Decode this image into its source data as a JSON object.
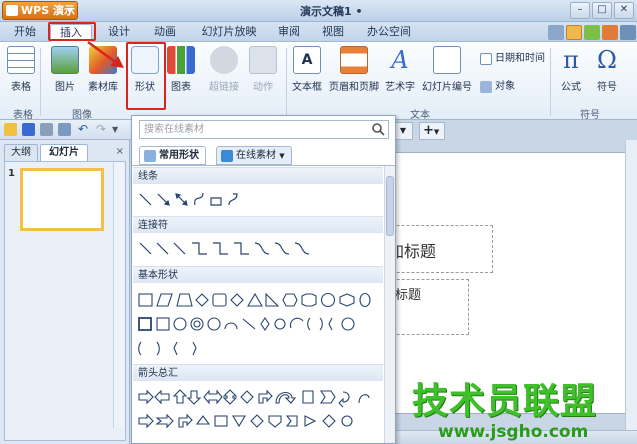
{
  "titlebar": {
    "app_button": "WPS 演示",
    "doc_title": "演示文稿1 •",
    "controls": [
      "–",
      "□",
      "✕"
    ]
  },
  "tabs": [
    "开始",
    "插入",
    "设计",
    "动画",
    "幻灯片放映",
    "审阅",
    "视图",
    "办公空间"
  ],
  "active_tab": "插入",
  "ribbon": {
    "table": "表格",
    "picture": "图片",
    "material": "素材库",
    "shape": "形状",
    "chart": "图表",
    "hyperlink": "超链接",
    "action": "动作",
    "textbox": "文本框",
    "header_footer": "页眉和页脚",
    "wordart": "艺术字",
    "slide_number": "幻灯片编号",
    "datetime": "日期和时间",
    "object": "对象",
    "formula": "公式",
    "symbol": "符号",
    "group_table": "表格",
    "group_image": "图像",
    "group_text": "文本",
    "group_symbol": "符号"
  },
  "left_panel": {
    "tab_outline": "大纲",
    "tab_slides": "幻灯片",
    "close": "×",
    "slide_number": "1"
  },
  "shapes_panel": {
    "search_placeholder": "搜索在线素材",
    "tab_common": "常用形状",
    "tab_online": "在线素材",
    "cat_lines": "线条",
    "cat_connectors": "连接符",
    "cat_basic": "基本形状",
    "cat_arrows": "箭头总汇"
  },
  "slide": {
    "title_placeholder": "加标题",
    "subtitle_placeholder": "加标题"
  },
  "doc_tab_add": "+",
  "watermark": {
    "text": "技术员联盟",
    "url": "www.jsgho.com"
  },
  "colors": {
    "highlight": "#d9261c",
    "watermark": "#3fbf2a"
  }
}
